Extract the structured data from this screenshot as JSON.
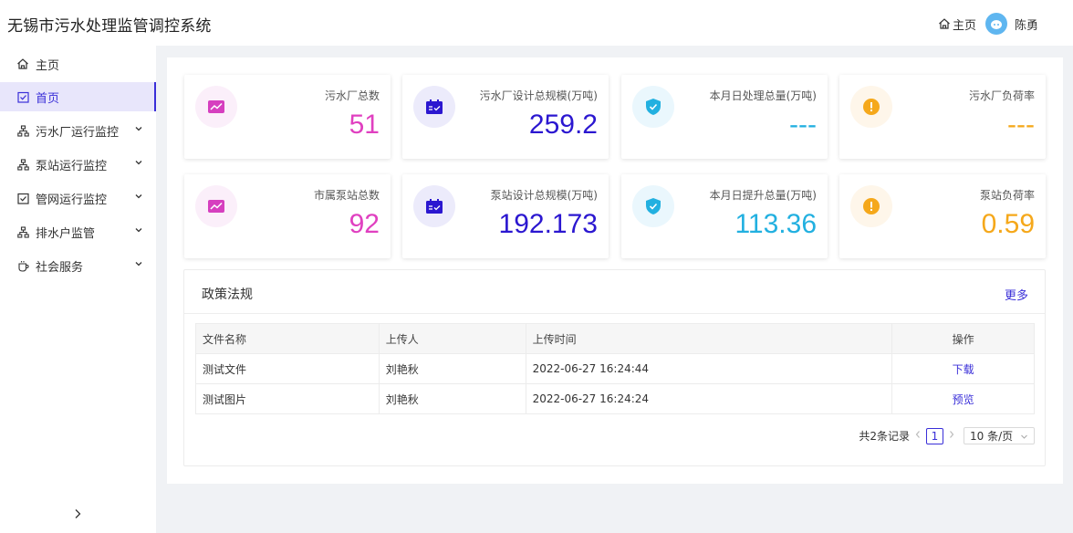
{
  "header": {
    "title": "无锡市污水处理监管调控系统",
    "home_label": "主页",
    "user_name": "陈勇"
  },
  "sidebar": {
    "items": [
      {
        "label": "主页",
        "icon": "home-icon"
      },
      {
        "label": "首页",
        "icon": "checkbox-icon",
        "active": true
      },
      {
        "label": "污水厂运行监控",
        "icon": "sitemap-icon",
        "expandable": true
      },
      {
        "label": "泵站运行监控",
        "icon": "sitemap-icon",
        "expandable": true
      },
      {
        "label": "管网运行监控",
        "icon": "checkbox-icon",
        "expandable": true
      },
      {
        "label": "排水户监管",
        "icon": "sitemap-icon",
        "expandable": true
      },
      {
        "label": "社会服务",
        "icon": "cup-icon",
        "expandable": true
      }
    ]
  },
  "stats": [
    {
      "label": "污水厂总数",
      "value": "51",
      "color": "#e040c0",
      "icon": "trend-icon",
      "icon_bg": "#fbeffa"
    },
    {
      "label": "污水厂设计总规模(万吨)",
      "value": "259.2",
      "color": "#2b17d0",
      "icon": "calendar-icon",
      "icon_bg": "#ecebfb"
    },
    {
      "label": "本月日处理总量(万吨)",
      "value": "---",
      "color": "#22b0e0",
      "icon": "shield-check-icon",
      "icon_bg": "#eaf7fd"
    },
    {
      "label": "污水厂负荷率",
      "value": "---",
      "color": "#f5a81b",
      "icon": "warning-icon",
      "icon_bg": "#fef6ea"
    },
    {
      "label": "市属泵站总数",
      "value": "92",
      "color": "#e040c0",
      "icon": "trend-icon",
      "icon_bg": "#fbeffa"
    },
    {
      "label": "泵站设计总规模(万吨)",
      "value": "192.173",
      "color": "#2b17d0",
      "icon": "calendar-icon",
      "icon_bg": "#ecebfb"
    },
    {
      "label": "本月日提升总量(万吨)",
      "value": "113.36",
      "color": "#22b0e0",
      "icon": "shield-check-icon",
      "icon_bg": "#eaf7fd"
    },
    {
      "label": "泵站负荷率",
      "value": "0.59",
      "color": "#f5a81b",
      "icon": "warning-icon",
      "icon_bg": "#fef6ea"
    }
  ],
  "policy": {
    "title": "政策法规",
    "more": "更多",
    "columns": [
      "文件名称",
      "上传人",
      "上传时间",
      "操作"
    ],
    "rows": [
      {
        "name": "测试文件",
        "uploader": "刘艳秋",
        "time": "2022-06-27 16:24:44",
        "action": "下载"
      },
      {
        "name": "测试图片",
        "uploader": "刘艳秋",
        "time": "2022-06-27 16:24:24",
        "action": "预览"
      }
    ],
    "pagination": {
      "total": "共2条记录",
      "page": "1",
      "page_size": "10 条/页"
    }
  },
  "colors": {
    "accent": "#3a2fd8",
    "active_bg": "#e8e6fb"
  }
}
